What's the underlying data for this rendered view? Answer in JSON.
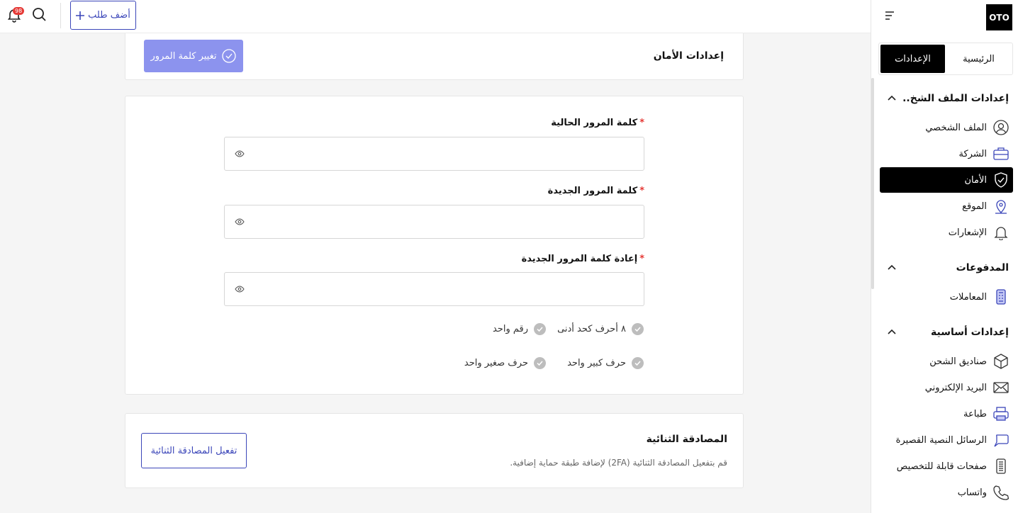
{
  "header": {
    "notification_count": "98",
    "add_order_label": "أضف طلب"
  },
  "sidebar": {
    "logo": "OTO",
    "tabs": [
      {
        "label": "الرئيسية"
      },
      {
        "label": "الإعدادات"
      }
    ],
    "sections": [
      {
        "title": "إعدادات الملف الشخ..",
        "items": [
          {
            "label": "الملف الشخصي",
            "icon": "user-icon"
          },
          {
            "label": "الشركة",
            "icon": "briefcase-icon"
          },
          {
            "label": "الأمان",
            "icon": "shield-icon"
          },
          {
            "label": "الموقع",
            "icon": "location-pin-icon"
          },
          {
            "label": "الإشعارات",
            "icon": "bell-icon"
          }
        ]
      },
      {
        "title": "المدفوعات",
        "items": [
          {
            "label": "المعاملات",
            "icon": "transactions-icon"
          }
        ]
      },
      {
        "title": "إعدادات أساسية",
        "items": [
          {
            "label": "صناديق الشحن",
            "icon": "box-icon"
          },
          {
            "label": "البريد الإلكتروني",
            "icon": "mail-icon"
          },
          {
            "label": "طباعة",
            "icon": "printer-icon"
          },
          {
            "label": "الرسائل النصية القصيرة",
            "icon": "message-icon"
          },
          {
            "label": "صفحات قابلة للتخصيص",
            "icon": "page-icon"
          },
          {
            "label": "واتساب",
            "icon": "phone-icon"
          }
        ]
      }
    ]
  },
  "security": {
    "title": "إعدادات الأمان",
    "change_password_label": "تغيير كلمة المرور"
  },
  "password_form": {
    "current_label": "كلمة المرور الحالية",
    "new_label": "كلمة المرور الجديدة",
    "confirm_label": "إعادة كلمة المرور الجديدة",
    "required_mark": "*",
    "rules": [
      "٨ أحرف كحد أدنى",
      "رقم واحد",
      "حرف كبير واحد",
      "حرف صغير واحد"
    ]
  },
  "two_factor": {
    "title": "المصادقة الثنائية",
    "description": "قم بتفعيل المصادقة الثنائية (2FA) لإضافة طبقة حماية إضافية.",
    "enable_label": "تفعيل المصادقة الثنائية"
  },
  "colors": {
    "accent": "#3b46b9",
    "button_disabled": "#8c93ee",
    "required": "#e53935"
  }
}
